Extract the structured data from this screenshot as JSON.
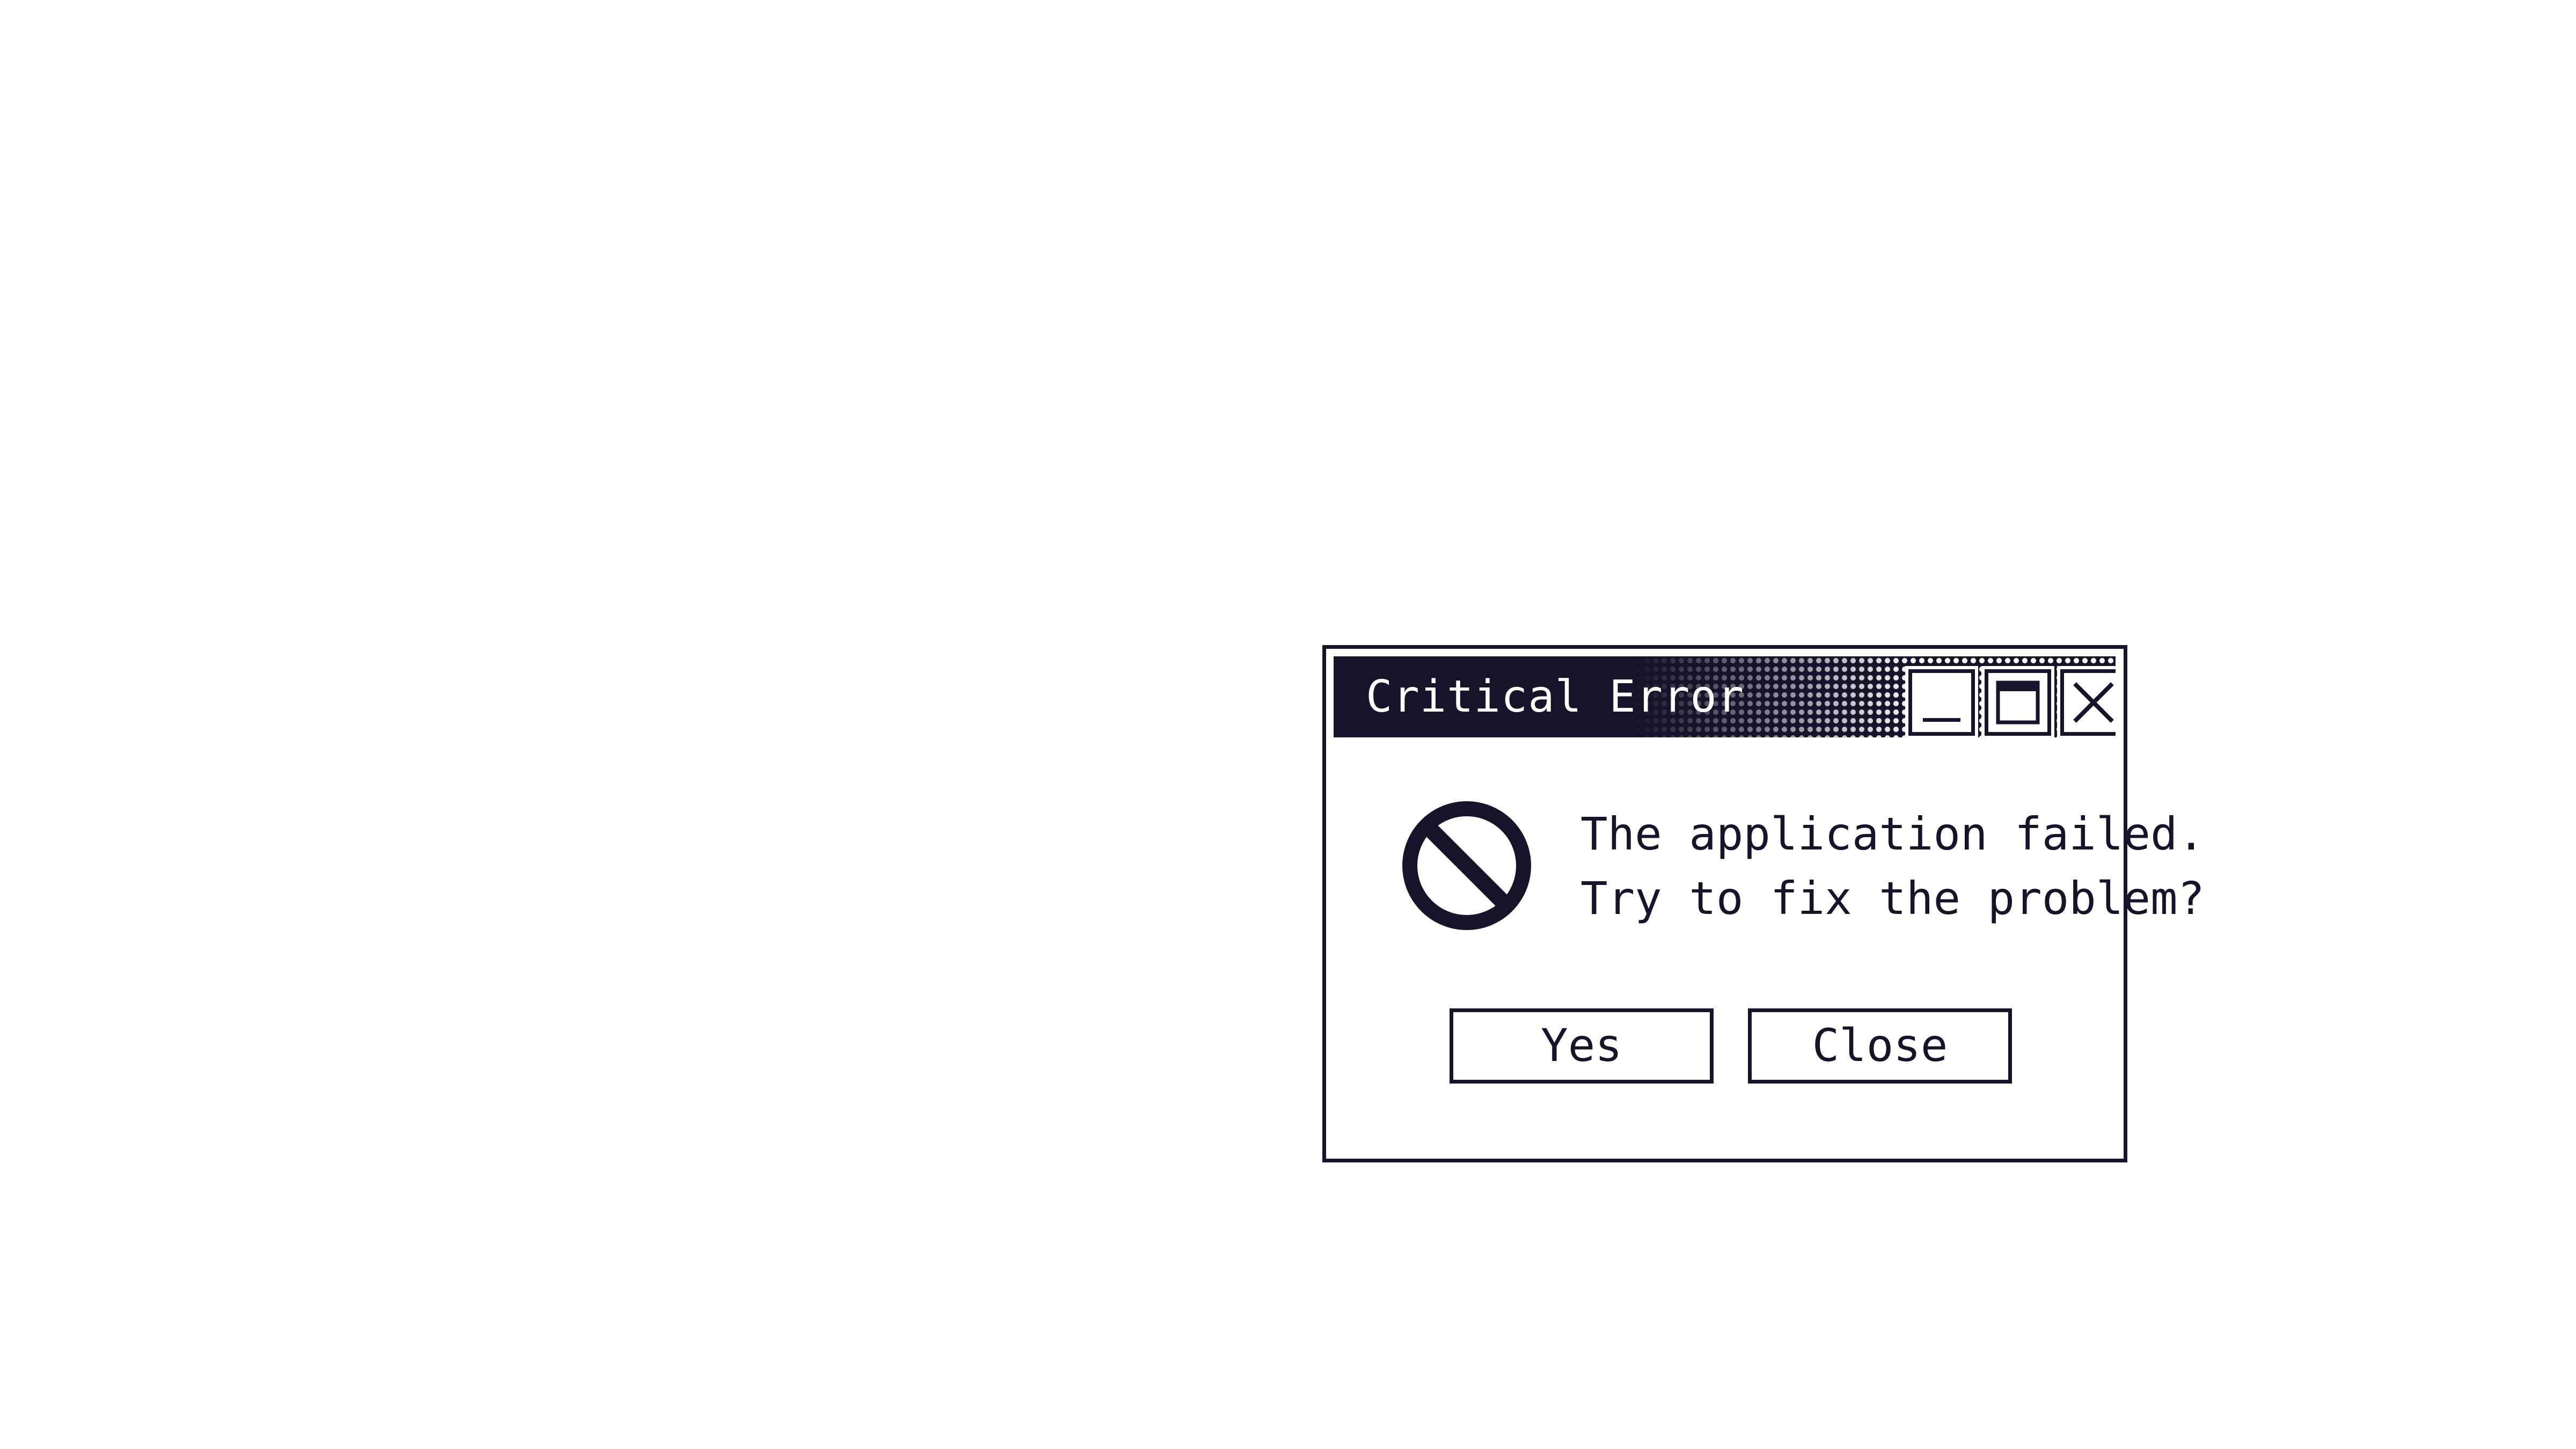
{
  "dialog": {
    "title": "Critical Error",
    "title_buttons": {
      "minimize_icon": "minimize-icon",
      "maximize_icon": "maximize-icon",
      "close_icon": "close-icon"
    },
    "icon": "no-entry-icon",
    "message": {
      "line1": "The application failed.",
      "line2": "Try to fix the problem?"
    },
    "buttons": {
      "yes_label": "Yes",
      "close_label": "Close"
    }
  },
  "colors": {
    "ink": "#16142a",
    "background": "#ffffff"
  }
}
